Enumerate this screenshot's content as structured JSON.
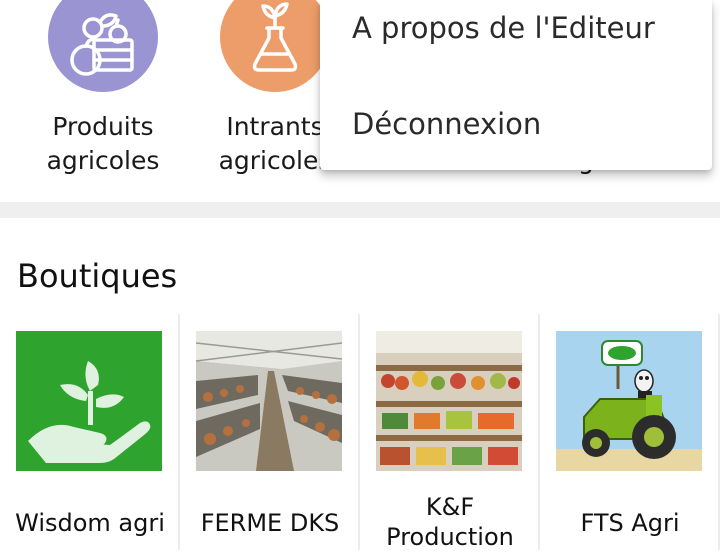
{
  "categories": [
    {
      "label": "Produits agricoles",
      "icon": "produce-basket-icon",
      "color": "#9b94d2"
    },
    {
      "label": "Intrants agricoles",
      "icon": "flask-sprout-icon",
      "color": "#ec9d69"
    }
  ],
  "partial_category_fragment": "g",
  "shops_section": {
    "title": "Boutiques",
    "shops": [
      {
        "name": "Wisdom agri",
        "image": "hand-sprout-icon",
        "color": "#2ea42e"
      },
      {
        "name": "FERME DKS",
        "image": "poultry-farm-photo"
      },
      {
        "name": "K&F Production",
        "image": "vegetable-stall-photo"
      },
      {
        "name": "FTS Agri",
        "image": "cow-tractor-illustration"
      }
    ]
  },
  "overflow_menu": {
    "items": [
      {
        "label": "A propos de l'Editeur"
      },
      {
        "label": "Déconnexion"
      }
    ]
  }
}
